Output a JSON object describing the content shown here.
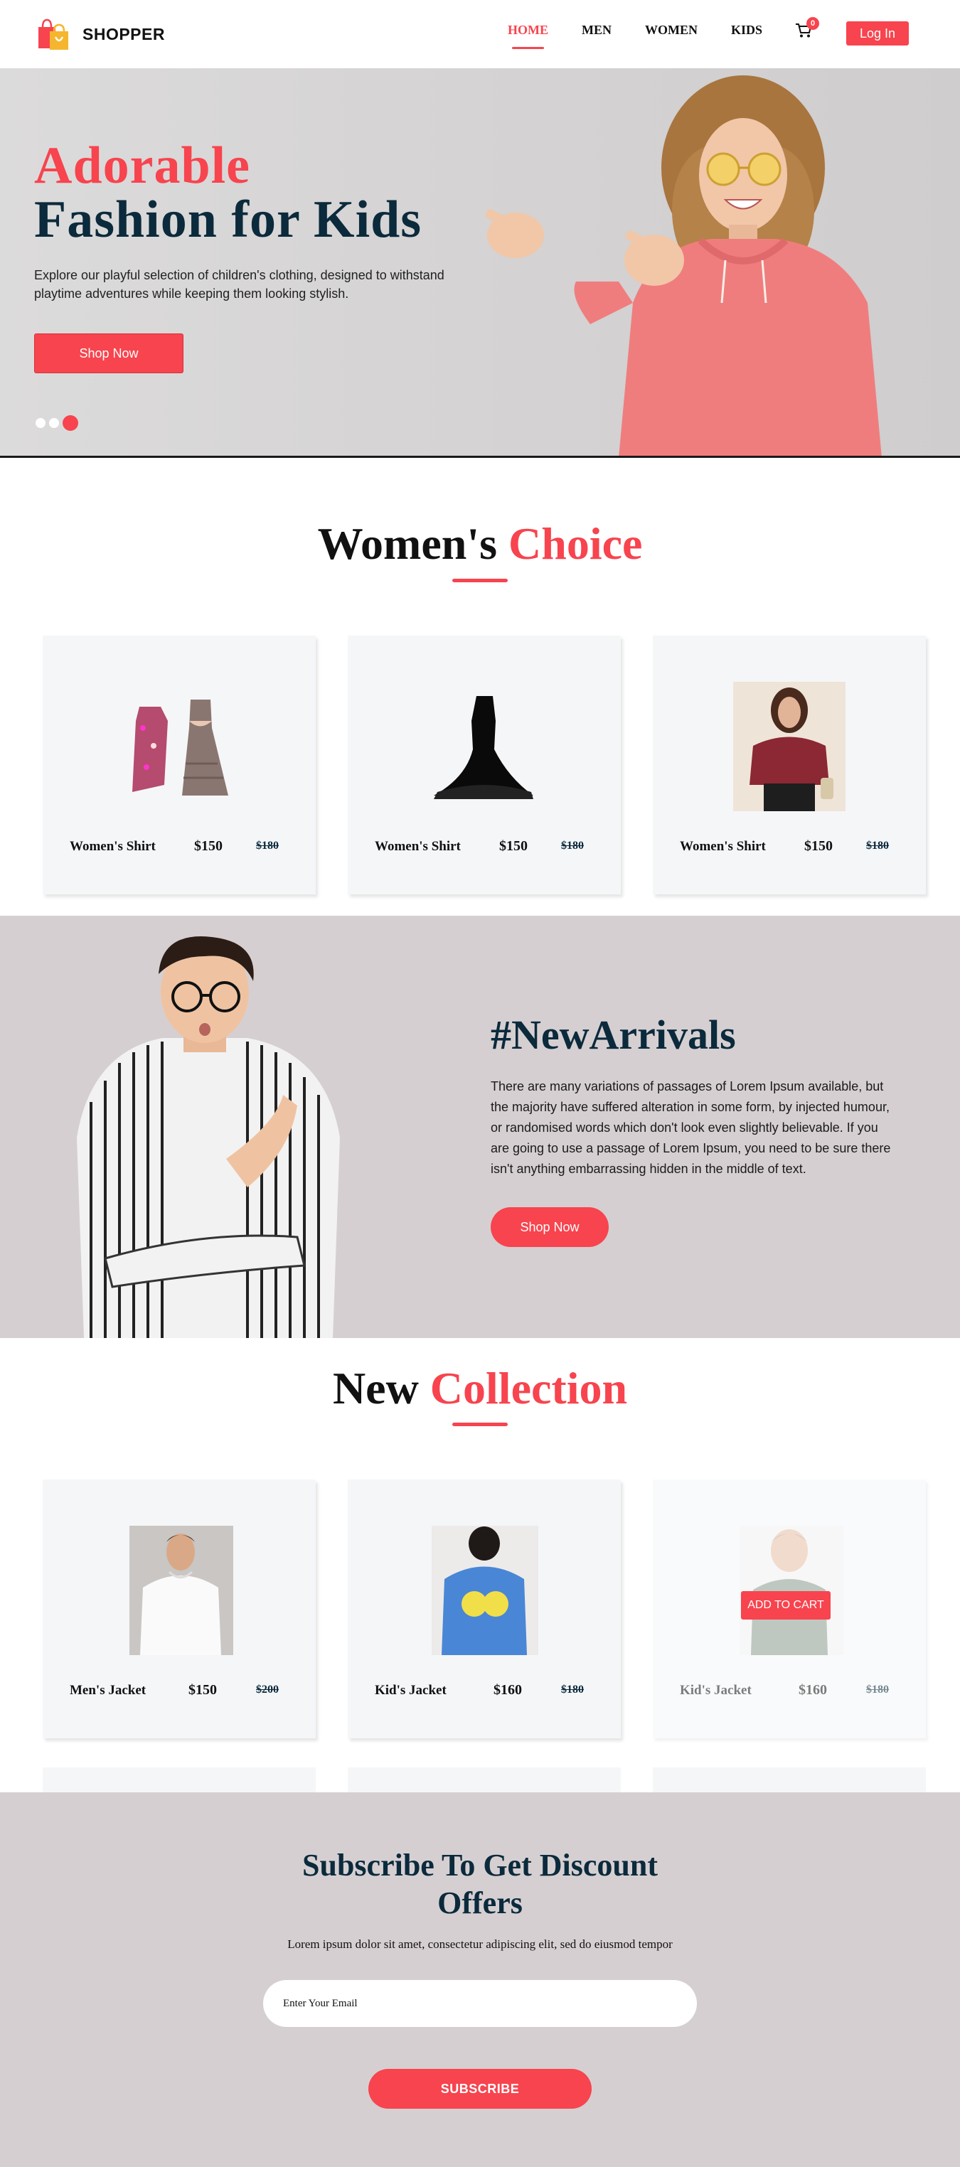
{
  "brand": {
    "name": "SHOPPER"
  },
  "nav": {
    "items": [
      {
        "label": "HOME",
        "active": true
      },
      {
        "label": "MEN",
        "active": false
      },
      {
        "label": "WOMEN",
        "active": false
      },
      {
        "label": "KIDS",
        "active": false
      }
    ],
    "cart_count": "0",
    "login_label": "Log In"
  },
  "hero": {
    "title_line1": "Adorable",
    "title_line2": "Fashion for Kids",
    "description": "Explore our playful selection of children's clothing, designed to withstand playtime adventures while keeping them looking stylish.",
    "cta": "Shop Now",
    "slides": 3,
    "active_slide": 3
  },
  "womens_choice": {
    "title_main": "Women's",
    "title_accent": "Choice",
    "products": [
      {
        "name": "Women's Shirt",
        "price": "$150",
        "old_price": "$180",
        "image": "floral-dresses"
      },
      {
        "name": "Women's Shirt",
        "price": "$150",
        "old_price": "$180",
        "image": "black-gown"
      },
      {
        "name": "Women's Shirt",
        "price": "$150",
        "old_price": "$180",
        "image": "maroon-top-woman"
      }
    ]
  },
  "new_arrivals": {
    "title": "#NewArrivals",
    "description": "There are many variations of passages of Lorem Ipsum available, but the majority have suffered alteration in some form, by injected humour, or randomised words which don't look even slightly believable. If you are going to use a passage of Lorem Ipsum, you need to be sure there isn't anything embarrassing hidden in the middle of text.",
    "cta": "Shop Now"
  },
  "new_collection": {
    "title_main": "New",
    "title_accent": "Collection",
    "products": [
      {
        "name": "Men's Jacket",
        "price": "$150",
        "old_price": "$200",
        "image": "white-hoodie-man"
      },
      {
        "name": "Kid's Jacket",
        "price": "$160",
        "old_price": "$180",
        "image": "blue-hoodie-kid"
      },
      {
        "name": "Kid's Jacket",
        "price": "$160",
        "old_price": "$180",
        "image": "grey-sweater-kid",
        "hover_action": "ADD TO CART"
      }
    ]
  },
  "subscribe": {
    "title": "Subscribe To Get Discount Offers",
    "description": "Lorem ipsum dolor sit amet, consectetur adipiscing elit, sed do eiusmod tempor",
    "placeholder": "Enter Your Email",
    "button": "SUBSCRIBE"
  },
  "colors": {
    "accent": "#f7444e",
    "navy": "#0b2a3c",
    "section_bg": "#d6cfd1",
    "card_bg": "#f5f6f8"
  }
}
